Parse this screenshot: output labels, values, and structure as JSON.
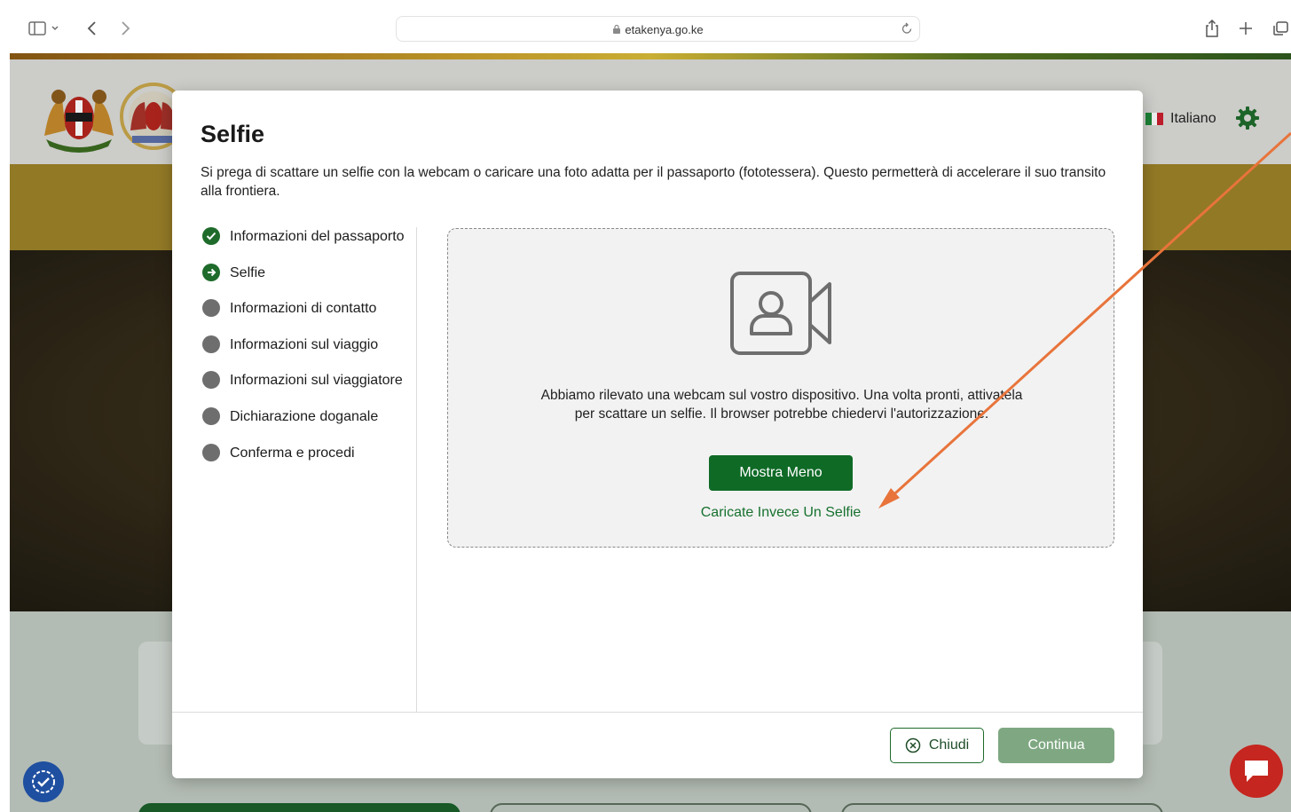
{
  "browser": {
    "url": "etakenya.go.ke"
  },
  "header": {
    "language": "Italiano"
  },
  "modal": {
    "title": "Selfie",
    "description": "Si prega di scattare un selfie con la webcam o caricare una foto adatta per il passaporto (fototessera). Questo permetterà di accelerare il suo transito alla frontiera.",
    "steps": [
      {
        "label": "Informazioni del passaporto",
        "status": "done"
      },
      {
        "label": "Selfie",
        "status": "current"
      },
      {
        "label": "Informazioni di contatto",
        "status": "pending"
      },
      {
        "label": "Informazioni sul viaggio",
        "status": "pending"
      },
      {
        "label": "Informazioni sul viaggiatore",
        "status": "pending"
      },
      {
        "label": "Dichiarazione doganale",
        "status": "pending"
      },
      {
        "label": "Conferma e procedi",
        "status": "pending"
      }
    ],
    "webcam_message": "Abbiamo rilevato una webcam sul vostro dispositivo. Una volta pronti, attivatela per scattare un selfie. Il browser potrebbe chiedervi l'autorizzazione.",
    "show_less_label": "Mostra Meno",
    "upload_link_label": "Caricate Invece Un Selfie",
    "close_label": "Chiudi",
    "continue_label": "Continua"
  },
  "colors": {
    "primary_green": "#0f6a26",
    "disabled_green": "#7fa882",
    "annotation_arrow": "#e8743b"
  },
  "icons": {
    "step_done": "check-circle-icon",
    "step_current": "arrow-right-circle-icon",
    "step_pending": "grey-circle-icon",
    "dropzone": "video-camera-user-icon"
  }
}
